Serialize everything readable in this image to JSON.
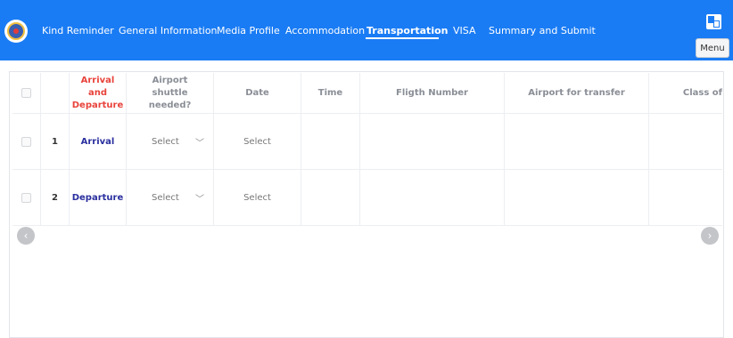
{
  "header": {
    "nav": [
      {
        "label": "Kind Reminder",
        "active": false
      },
      {
        "label": "General Information",
        "active": false
      },
      {
        "label": "Media Profile",
        "active": false
      },
      {
        "label": "Accommodation",
        "active": false
      },
      {
        "label": "Transportation",
        "active": true
      },
      {
        "label": "VISA",
        "active": false
      },
      {
        "label": "Summary and Submit",
        "active": false
      }
    ],
    "menu_label": "Menu",
    "logo_icon": "emblem-icon",
    "lang_icon": "translate-icon"
  },
  "table": {
    "columns": [
      "Arrival and Departure",
      "Airport shuttle needed?",
      "Date",
      "Time",
      "Fligth Number",
      "Airport for transfer",
      "Class of"
    ],
    "rows": [
      {
        "num": "1",
        "direction": "Arrival",
        "shuttle": "Select",
        "date": "Select"
      },
      {
        "num": "2",
        "direction": "Departure",
        "shuttle": "Select",
        "date": "Select"
      }
    ]
  },
  "colors": {
    "topbar": "#1a7cf4",
    "accent_red": "#e8433b",
    "direction_blue": "#2a2f9e"
  }
}
